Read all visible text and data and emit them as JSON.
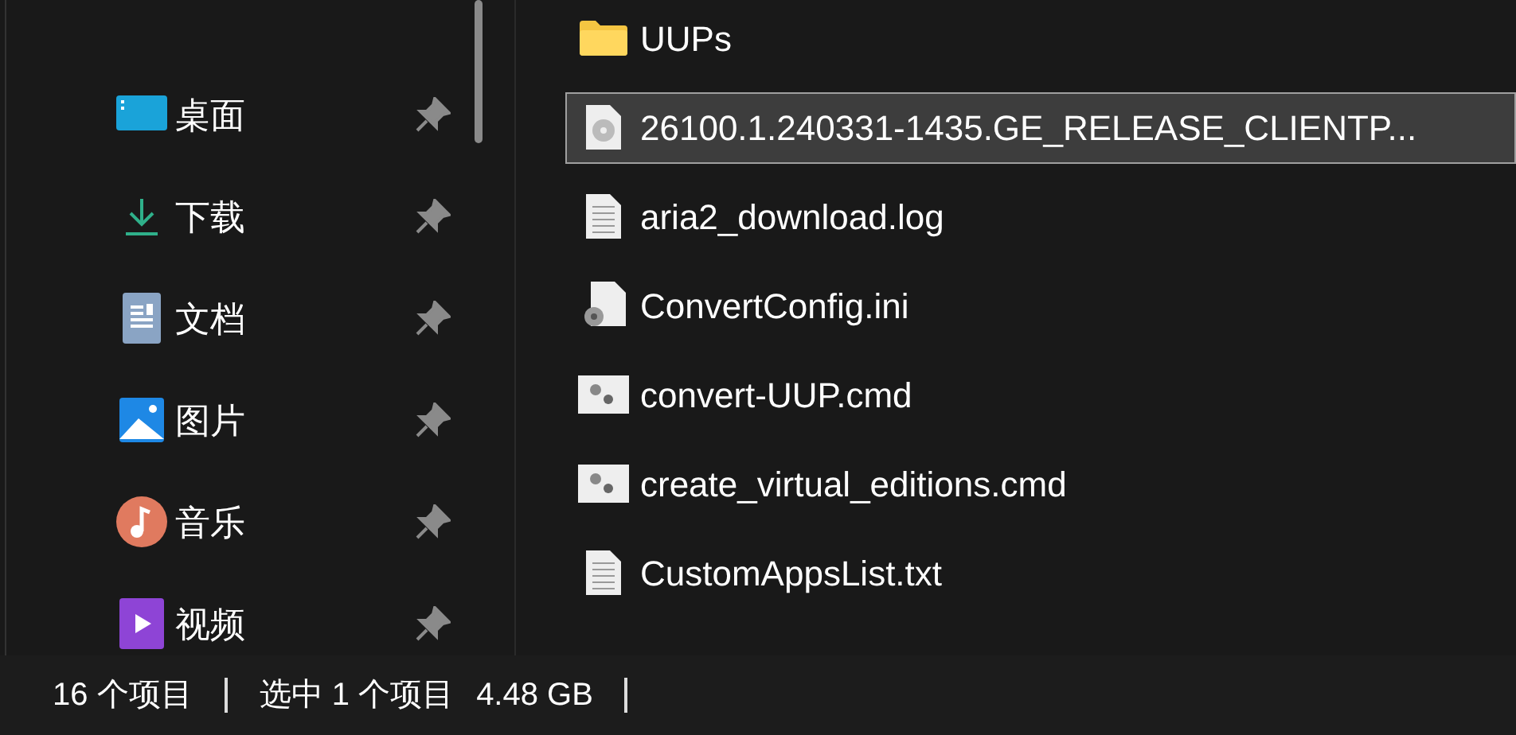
{
  "sidebar": {
    "items": [
      {
        "label": "桌面",
        "kind": "desktop",
        "pinned": true
      },
      {
        "label": "下载",
        "kind": "downloads",
        "pinned": true
      },
      {
        "label": "文档",
        "kind": "documents",
        "pinned": true
      },
      {
        "label": "图片",
        "kind": "pictures",
        "pinned": true
      },
      {
        "label": "音乐",
        "kind": "music",
        "pinned": true
      },
      {
        "label": "视频",
        "kind": "videos",
        "pinned": true
      }
    ]
  },
  "files": [
    {
      "name": "UUPs",
      "kind": "folder",
      "selected": false
    },
    {
      "name": "26100.1.240331-1435.GE_RELEASE_CLIENTP...",
      "kind": "disc",
      "selected": true
    },
    {
      "name": "aria2_download.log",
      "kind": "text",
      "selected": false
    },
    {
      "name": "ConvertConfig.ini",
      "kind": "config",
      "selected": false
    },
    {
      "name": "convert-UUP.cmd",
      "kind": "script",
      "selected": false
    },
    {
      "name": "create_virtual_editions.cmd",
      "kind": "script",
      "selected": false
    },
    {
      "name": "CustomAppsList.txt",
      "kind": "text",
      "selected": false
    }
  ],
  "status_bar": {
    "item_count": "16 个项目",
    "selection": "选中 1 个项目",
    "size": "4.48 GB"
  }
}
